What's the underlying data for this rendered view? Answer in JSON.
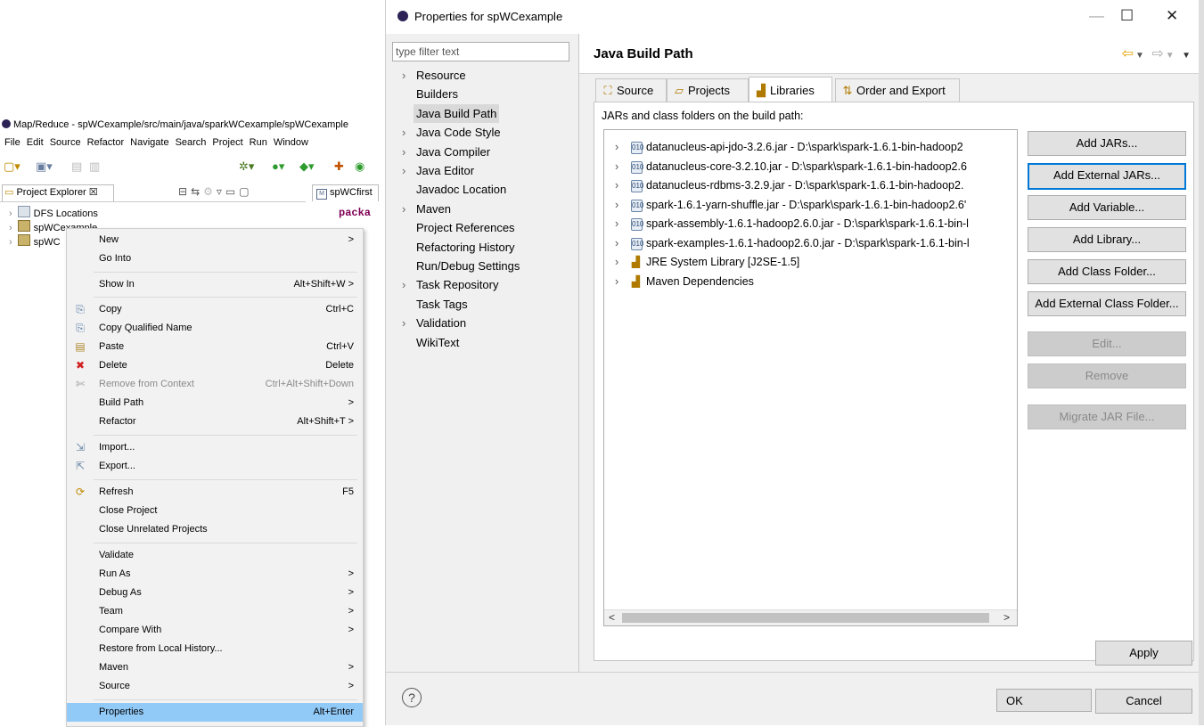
{
  "eclipse": {
    "title": "Map/Reduce - spWCexample/src/main/java/sparkWCexample/spWCexample",
    "menu": [
      "File",
      "Edit",
      "Source",
      "Refactor",
      "Navigate",
      "Search",
      "Project",
      "Run",
      "Window"
    ],
    "explorer_tab": "Project Explorer ☒",
    "editor_tab": "spWCfirst",
    "editor_code": "packa",
    "tree": [
      {
        "label": "DFS Locations",
        "icon": "dfs-icon"
      },
      {
        "label": "spWCexample",
        "icon": "project-icon"
      },
      {
        "label": "spWC",
        "icon": "project-icon"
      }
    ]
  },
  "context_menu": {
    "items": [
      {
        "label": "New",
        "accel": ">",
        "icon": "",
        "type": "item"
      },
      {
        "label": "Go Into",
        "accel": "",
        "icon": "",
        "type": "item"
      },
      {
        "type": "sep"
      },
      {
        "label": "Show In",
        "accel": "Alt+Shift+W >",
        "icon": "",
        "type": "item"
      },
      {
        "type": "sep"
      },
      {
        "label": "Copy",
        "accel": "Ctrl+C",
        "icon": "copy-icon",
        "type": "item"
      },
      {
        "label": "Copy Qualified Name",
        "accel": "",
        "icon": "copy-qualified-icon",
        "type": "item"
      },
      {
        "label": "Paste",
        "accel": "Ctrl+V",
        "icon": "paste-icon",
        "type": "item"
      },
      {
        "label": "Delete",
        "accel": "Delete",
        "icon": "delete-icon",
        "type": "item"
      },
      {
        "label": "Remove from Context",
        "accel": "Ctrl+Alt+Shift+Down",
        "icon": "remove-context-icon",
        "type": "disabled"
      },
      {
        "label": "Build Path",
        "accel": ">",
        "icon": "",
        "type": "item"
      },
      {
        "label": "Refactor",
        "accel": "Alt+Shift+T >",
        "icon": "",
        "type": "item"
      },
      {
        "type": "sep"
      },
      {
        "label": "Import...",
        "accel": "",
        "icon": "import-icon",
        "type": "item"
      },
      {
        "label": "Export...",
        "accel": "",
        "icon": "export-icon",
        "type": "item"
      },
      {
        "type": "sep"
      },
      {
        "label": "Refresh",
        "accel": "F5",
        "icon": "refresh-icon",
        "type": "item"
      },
      {
        "label": "Close Project",
        "accel": "",
        "icon": "",
        "type": "item"
      },
      {
        "label": "Close Unrelated Projects",
        "accel": "",
        "icon": "",
        "type": "item"
      },
      {
        "type": "sep"
      },
      {
        "label": "Validate",
        "accel": "",
        "icon": "",
        "type": "item"
      },
      {
        "label": "Run As",
        "accel": ">",
        "icon": "",
        "type": "item"
      },
      {
        "label": "Debug As",
        "accel": ">",
        "icon": "",
        "type": "item"
      },
      {
        "label": "Team",
        "accel": ">",
        "icon": "",
        "type": "item"
      },
      {
        "label": "Compare With",
        "accel": ">",
        "icon": "",
        "type": "item"
      },
      {
        "label": "Restore from Local History...",
        "accel": "",
        "icon": "",
        "type": "item"
      },
      {
        "label": "Maven",
        "accel": ">",
        "icon": "",
        "type": "item"
      },
      {
        "label": "Source",
        "accel": ">",
        "icon": "",
        "type": "item"
      },
      {
        "type": "sep"
      },
      {
        "label": "Properties",
        "accel": "Alt+Enter",
        "icon": "",
        "type": "highlighted"
      }
    ]
  },
  "dialog": {
    "title": "Properties for spWCexample",
    "filter_placeholder": "type filter text",
    "nav": [
      {
        "label": "Resource",
        "expandable": true,
        "selected": false
      },
      {
        "label": "Builders",
        "expandable": false,
        "selected": false
      },
      {
        "label": "Java Build Path",
        "expandable": false,
        "selected": true
      },
      {
        "label": "Java Code Style",
        "expandable": true,
        "selected": false
      },
      {
        "label": "Java Compiler",
        "expandable": true,
        "selected": false
      },
      {
        "label": "Java Editor",
        "expandable": true,
        "selected": false
      },
      {
        "label": "Javadoc Location",
        "expandable": false,
        "selected": false
      },
      {
        "label": "Maven",
        "expandable": true,
        "selected": false
      },
      {
        "label": "Project References",
        "expandable": false,
        "selected": false
      },
      {
        "label": "Refactoring History",
        "expandable": false,
        "selected": false
      },
      {
        "label": "Run/Debug Settings",
        "expandable": false,
        "selected": false
      },
      {
        "label": "Task Repository",
        "expandable": true,
        "selected": false
      },
      {
        "label": "Task Tags",
        "expandable": false,
        "selected": false
      },
      {
        "label": "Validation",
        "expandable": true,
        "selected": false
      },
      {
        "label": "WikiText",
        "expandable": false,
        "selected": false
      }
    ],
    "page_title": "Java Build Path",
    "tabs": [
      {
        "label": "Source",
        "icon": "source-folder-icon",
        "active": false
      },
      {
        "label": "Projects",
        "icon": "projects-folder-icon",
        "active": false
      },
      {
        "label": "Libraries",
        "icon": "libraries-icon",
        "active": true
      },
      {
        "label": "Order and Export",
        "icon": "order-export-icon",
        "active": false
      }
    ],
    "libraries_label": "JARs and class folders on the build path:",
    "libraries": [
      {
        "label": "datanucleus-api-jdo-3.2.6.jar - D:\\spark\\spark-1.6.1-bin-hadoop2",
        "kind": "jar"
      },
      {
        "label": "datanucleus-core-3.2.10.jar - D:\\spark\\spark-1.6.1-bin-hadoop2.6",
        "kind": "jar"
      },
      {
        "label": "datanucleus-rdbms-3.2.9.jar - D:\\spark\\spark-1.6.1-bin-hadoop2.",
        "kind": "jar"
      },
      {
        "label": "spark-1.6.1-yarn-shuffle.jar - D:\\spark\\spark-1.6.1-bin-hadoop2.6'",
        "kind": "jar"
      },
      {
        "label": "spark-assembly-1.6.1-hadoop2.6.0.jar - D:\\spark\\spark-1.6.1-bin-l",
        "kind": "jar"
      },
      {
        "label": "spark-examples-1.6.1-hadoop2.6.0.jar - D:\\spark\\spark-1.6.1-bin-l",
        "kind": "jar"
      },
      {
        "label": "JRE System Library [J2SE-1.5]",
        "kind": "library"
      },
      {
        "label": "Maven Dependencies",
        "kind": "library"
      }
    ],
    "buttons": {
      "add_jars": "Add JARs...",
      "add_external_jars": "Add External JARs...",
      "add_variable": "Add Variable...",
      "add_library": "Add Library...",
      "add_class_folder": "Add Class Folder...",
      "add_external_class_folder": "Add External Class Folder...",
      "edit": "Edit...",
      "remove": "Remove",
      "migrate_jar": "Migrate JAR File...",
      "apply": "Apply",
      "ok": "OK",
      "cancel": "Cancel"
    },
    "colors": {
      "selection": "#91c9f7",
      "focus_border": "#0078d7",
      "keyword": "#7f0055"
    }
  }
}
